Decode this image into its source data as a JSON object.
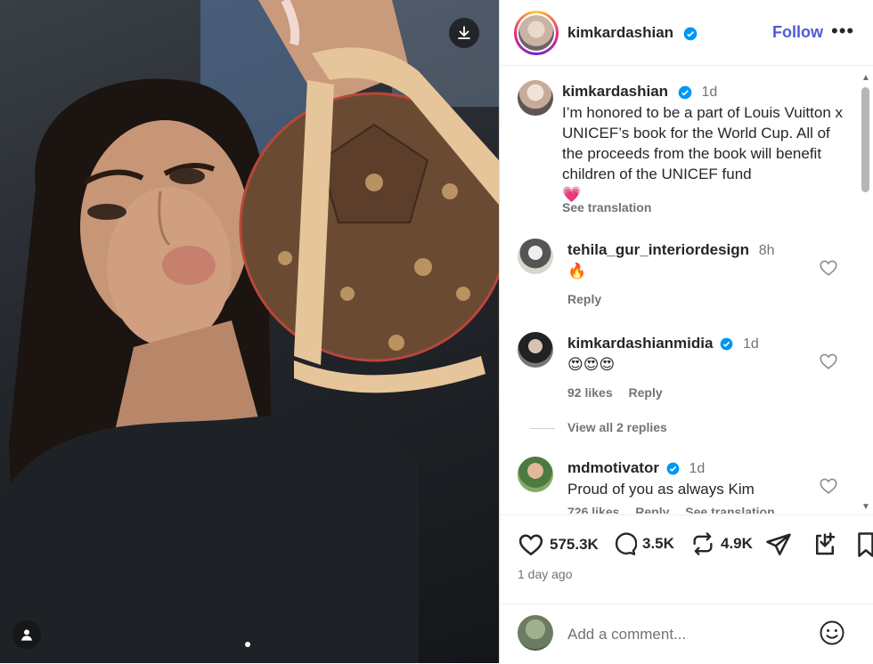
{
  "post": {
    "username": "kimkardashian",
    "follow_label": "Follow",
    "more_label": "•••"
  },
  "caption": {
    "username": "kimkardashian",
    "time": "1d",
    "text": "I’m honored to be a part of Louis Vuitton x UNICEF’s book for the World Cup. All of the proceeds from the book will benefit children of the UNICEF fund",
    "emoji": "💗",
    "see_translation": "See translation"
  },
  "comments": [
    {
      "username": "tehila_gur_interiordesign",
      "time": "8h",
      "verified": false,
      "text": "🔥",
      "likes": "",
      "reply_label": "Reply"
    },
    {
      "username": "kimkardashianmidia",
      "time": "1d",
      "verified": true,
      "text": "😍😍😍",
      "likes": "92 likes",
      "reply_label": "Reply"
    },
    {
      "username": "mdmotivator",
      "time": "1d",
      "verified": true,
      "text": "Proud of you as always Kim",
      "likes": "726 likes",
      "reply_label": "Reply",
      "translation_label": "See translation"
    }
  ],
  "view_replies": "View all 2 replies",
  "actions": {
    "likes": "575.3K",
    "comments": "3.5K",
    "reposts": "4.9K"
  },
  "time_ago": "1 day ago",
  "add_comment": {
    "placeholder": "Add a comment..."
  },
  "colors": {
    "accent": "#4f5bd5",
    "verified": "#0095f6",
    "muted": "#737373"
  },
  "icons": [
    "download-icon",
    "verified-badge-icon",
    "more-icon",
    "heart-icon",
    "comment-icon",
    "repost-icon",
    "share-icon",
    "save-icon",
    "bookmark-icon",
    "emoji-icon",
    "user-tag-icon"
  ]
}
